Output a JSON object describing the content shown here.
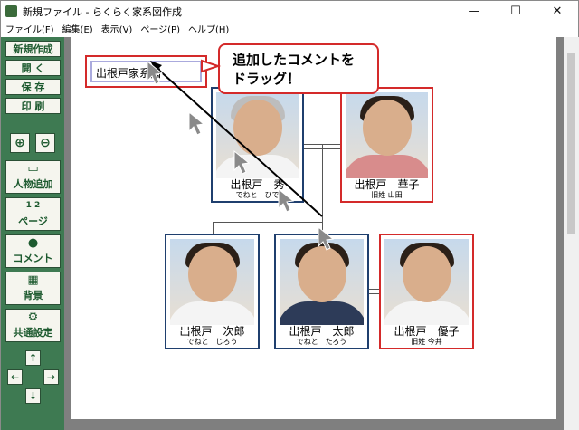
{
  "window": {
    "title": "新規ファイル - らくらく家系図作成"
  },
  "menu": [
    "ファイル(F)",
    "編集(E)",
    "表示(V)",
    "ページ(P)",
    "ヘルプ(H)"
  ],
  "sidebar": {
    "new_label": "新規作成",
    "open_label": "開 く",
    "save_label": "保 存",
    "print_label": "印 刷",
    "add_person_label": "人物追加",
    "page_label": "ページ",
    "page_glyph": "1 2",
    "comment_label": "コメント",
    "background_label": "背景",
    "settings_label": "共通設定"
  },
  "comment_box": {
    "text": "出根戸家系図"
  },
  "callout": {
    "line1": "追加したコメントを",
    "line2": "ドラッグ！"
  },
  "people": {
    "father": {
      "name": "出根戸　秀",
      "reading": "でねと　ひで"
    },
    "mother": {
      "name": "出根戸　華子",
      "reading": "旧姓 山田"
    },
    "son2": {
      "name": "出根戸　次郎",
      "reading": "でねと　じろう"
    },
    "son1": {
      "name": "出根戸　太郎",
      "reading": "でねと　たろう"
    },
    "wife": {
      "name": "出根戸　優子",
      "reading": "旧姓 今井"
    }
  },
  "colors": {
    "accent_red": "#d42a2a",
    "card_navy": "#1f3f6e",
    "sidebar_green": "#3e7a52"
  }
}
